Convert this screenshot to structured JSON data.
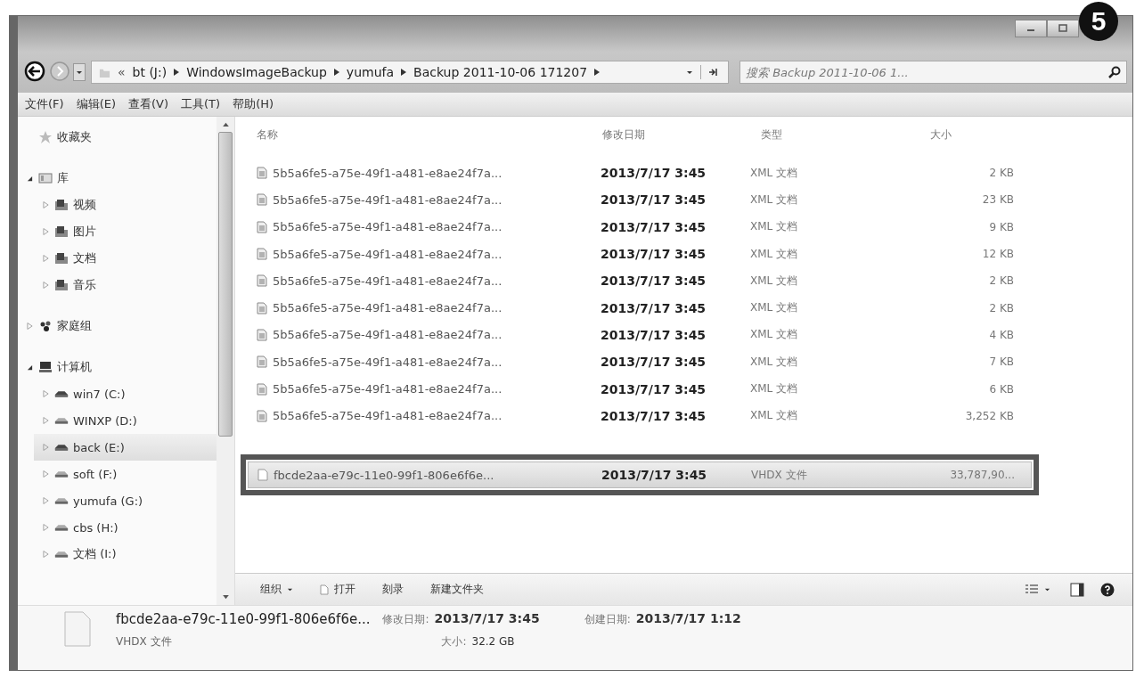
{
  "step_badge": "5",
  "address_bar": {
    "overflow": "«",
    "crumbs": [
      "bt (J:)",
      "WindowsImageBackup",
      "yumufa",
      "Backup 2011-10-06 171207"
    ]
  },
  "search": {
    "placeholder": "搜索 Backup 2011-10-06 1..."
  },
  "menu": [
    "文件(F)",
    "编辑(E)",
    "查看(V)",
    "工具(T)",
    "帮助(H)"
  ],
  "sidebar": [
    {
      "label": "收藏夹",
      "kind": "favorites",
      "selected": false
    },
    {
      "label": "库",
      "kind": "library",
      "expanded": true,
      "selected": false,
      "children": [
        {
          "label": "视频",
          "kind": "video",
          "expanded": false,
          "selected": false
        },
        {
          "label": "图片",
          "kind": "pictures",
          "expanded": false,
          "selected": false
        },
        {
          "label": "文档",
          "kind": "documents",
          "expanded": false,
          "selected": false
        },
        {
          "label": "音乐",
          "kind": "music",
          "expanded": false,
          "selected": false
        }
      ]
    },
    {
      "label": "家庭组",
      "kind": "homegroup",
      "expanded": false,
      "selected": false
    },
    {
      "label": "计算机",
      "kind": "computer",
      "expanded": true,
      "selected": false,
      "children": [
        {
          "label": "win7 (C:)",
          "kind": "system-drive",
          "expanded": false,
          "selected": false
        },
        {
          "label": "WINXP (D:)",
          "kind": "drive",
          "expanded": false,
          "selected": false
        },
        {
          "label": "back (E:)",
          "kind": "backup-drive",
          "expanded": false,
          "selected": true
        },
        {
          "label": "soft (F:)",
          "kind": "drive",
          "expanded": false,
          "selected": false
        },
        {
          "label": "yumufa (G:)",
          "kind": "drive",
          "expanded": false,
          "selected": false
        },
        {
          "label": "cbs (H:)",
          "kind": "drive",
          "expanded": false,
          "selected": false
        },
        {
          "label": "文档 (I:)",
          "kind": "drive",
          "expanded": false,
          "selected": false
        }
      ]
    }
  ],
  "columns": [
    "名称",
    "修改日期",
    "类型",
    "大小"
  ],
  "rows": [
    {
      "name": "5b5a6fe5-a75e-49f1-a481-e8ae24f7a...",
      "date": "2013/7/17  3:45",
      "type": "XML 文档",
      "size": "2 KB",
      "kind": "xml",
      "selected": false
    },
    {
      "name": "5b5a6fe5-a75e-49f1-a481-e8ae24f7a...",
      "date": "2013/7/17  3:45",
      "type": "XML 文档",
      "size": "23 KB",
      "kind": "xml",
      "selected": false
    },
    {
      "name": "5b5a6fe5-a75e-49f1-a481-e8ae24f7a...",
      "date": "2013/7/17  3:45",
      "type": "XML 文档",
      "size": "9 KB",
      "kind": "xml",
      "selected": false
    },
    {
      "name": "5b5a6fe5-a75e-49f1-a481-e8ae24f7a...",
      "date": "2013/7/17  3:45",
      "type": "XML 文档",
      "size": "12 KB",
      "kind": "xml",
      "selected": false
    },
    {
      "name": "5b5a6fe5-a75e-49f1-a481-e8ae24f7a...",
      "date": "2013/7/17  3:45",
      "type": "XML 文档",
      "size": "2 KB",
      "kind": "xml",
      "selected": false
    },
    {
      "name": "5b5a6fe5-a75e-49f1-a481-e8ae24f7a...",
      "date": "2013/7/17  3:45",
      "type": "XML 文档",
      "size": "2 KB",
      "kind": "xml",
      "selected": false
    },
    {
      "name": "5b5a6fe5-a75e-49f1-a481-e8ae24f7a...",
      "date": "2013/7/17  3:45",
      "type": "XML 文档",
      "size": "4 KB",
      "kind": "xml",
      "selected": false
    },
    {
      "name": "5b5a6fe5-a75e-49f1-a481-e8ae24f7a...",
      "date": "2013/7/17  3:45",
      "type": "XML 文档",
      "size": "7 KB",
      "kind": "xml",
      "selected": false
    },
    {
      "name": "5b5a6fe5-a75e-49f1-a481-e8ae24f7a...",
      "date": "2013/7/17  3:45",
      "type": "XML 文档",
      "size": "6 KB",
      "kind": "xml",
      "selected": false
    },
    {
      "name": "5b5a6fe5-a75e-49f1-a481-e8ae24f7a...",
      "date": "2013/7/17  3:45",
      "type": "XML 文档",
      "size": "3,252 KB",
      "kind": "xml",
      "selected": false
    },
    {
      "name": "fbcde2aa-e79c-11e0-99f1-806e6f6e...",
      "date": "2013/7/17  3:45",
      "type": "VHDX 文件",
      "size": "33,787,90...",
      "kind": "file",
      "selected": true
    }
  ],
  "commands": [
    {
      "label": "组织",
      "kind": "menu"
    },
    {
      "label": "打开",
      "kind": "open"
    },
    {
      "label": "刻录",
      "kind": "plain"
    },
    {
      "label": "新建文件夹",
      "kind": "plain"
    }
  ],
  "details": {
    "name": "fbcde2aa-e79c-11e0-99f1-806e6f6e...",
    "type": "VHDX 文件",
    "modified_label": "修改日期:",
    "modified": "2013/7/17  3:45",
    "size_label": "大小:",
    "size": "32.2 GB",
    "created_label": "创建日期:",
    "created": "2013/7/17  1:12"
  }
}
